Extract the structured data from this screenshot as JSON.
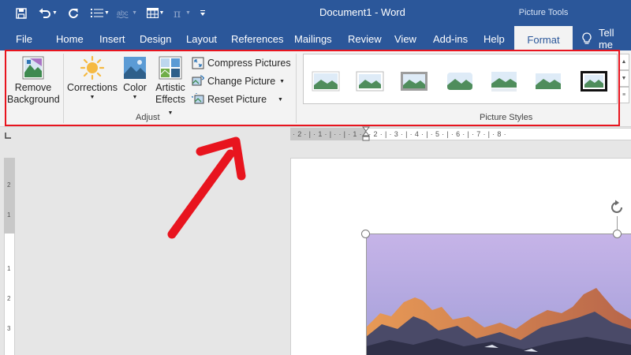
{
  "titlebar": {
    "document_title": "Document1  -  Word",
    "context_tab_group": "Picture Tools",
    "qat_icons": [
      "save-icon",
      "undo-icon",
      "redo-icon",
      "bullets-icon",
      "spelling-icon",
      "table-icon",
      "equation-icon",
      "customize-icon"
    ]
  },
  "tabs": [
    {
      "label": "File"
    },
    {
      "label": "Home"
    },
    {
      "label": "Insert"
    },
    {
      "label": "Design"
    },
    {
      "label": "Layout"
    },
    {
      "label": "References"
    },
    {
      "label": "Mailings"
    },
    {
      "label": "Review"
    },
    {
      "label": "View"
    },
    {
      "label": "Add-ins"
    },
    {
      "label": "Help"
    },
    {
      "label": "Format",
      "active": true
    }
  ],
  "tell_me": {
    "label": "Tell me"
  },
  "ribbon": {
    "adjust": {
      "group_label": "Adjust",
      "remove_background": {
        "line1": "Remove",
        "line2": "Background"
      },
      "corrections": {
        "label": "Corrections"
      },
      "color": {
        "label": "Color"
      },
      "artistic_effects": {
        "line1": "Artistic",
        "line2": "Effects"
      },
      "compress_pictures": {
        "label": "Compress Pictures"
      },
      "change_picture": {
        "label": "Change Picture"
      },
      "reset_picture": {
        "label": "Reset Picture"
      }
    },
    "picture_styles": {
      "group_label": "Picture Styles",
      "style_count": 7
    }
  },
  "ruler": {
    "horizontal": "· 2 · | · 1 · | ·   · | · 1 · | · 2 · | · 3 · | · 4 · | · 5 · | · 6 · | · 7 · | · 8 ·",
    "vertical": [
      "2",
      "1",
      "1",
      "2",
      "3"
    ]
  },
  "colors": {
    "word_blue": "#2b579a",
    "ribbon_bg": "#f3f3f3",
    "highlight_red": "#e8141e"
  }
}
